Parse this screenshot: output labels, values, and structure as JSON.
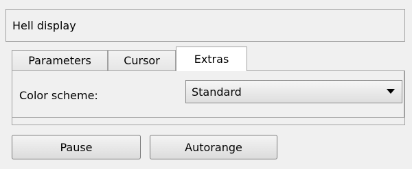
{
  "header": {
    "title": "Hell display"
  },
  "tabs": [
    {
      "label": "Parameters",
      "active": false
    },
    {
      "label": "Cursor",
      "active": false
    },
    {
      "label": "Extras",
      "active": true
    }
  ],
  "extras": {
    "color_scheme_label": "Color scheme:",
    "color_scheme_value": "Standard"
  },
  "buttons": {
    "pause": "Pause",
    "autorange": "Autorange"
  }
}
